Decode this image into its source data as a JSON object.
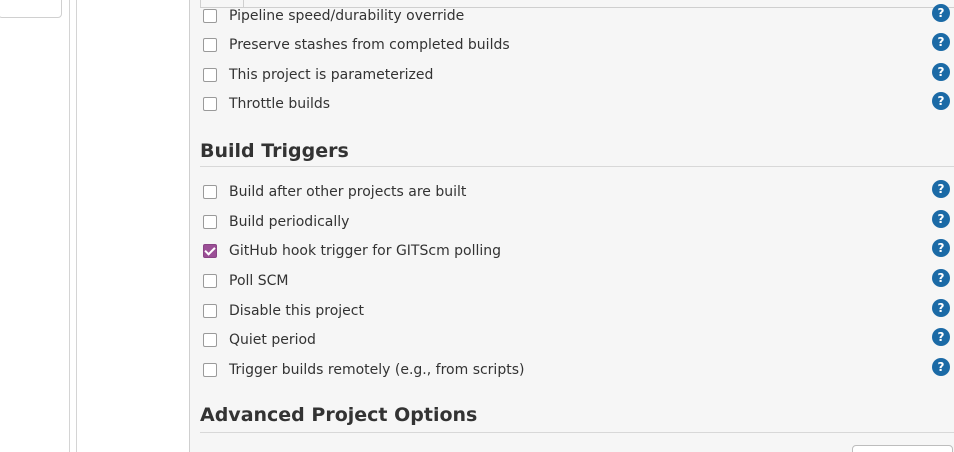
{
  "general_options": [
    {
      "label": "Pipeline speed/durability override",
      "checked": false
    },
    {
      "label": "Preserve stashes from completed builds",
      "checked": false
    },
    {
      "label": "This project is parameterized",
      "checked": false
    },
    {
      "label": "Throttle builds",
      "checked": false
    }
  ],
  "build_triggers": {
    "title": "Build Triggers",
    "options": [
      {
        "label": "Build after other projects are built",
        "checked": false
      },
      {
        "label": "Build periodically",
        "checked": false
      },
      {
        "label": "GitHub hook trigger for GITScm polling",
        "checked": true
      },
      {
        "label": "Poll SCM",
        "checked": false
      },
      {
        "label": "Disable this project",
        "checked": false
      },
      {
        "label": "Quiet period",
        "checked": false
      },
      {
        "label": "Trigger builds remotely (e.g., from scripts)",
        "checked": false
      }
    ]
  },
  "advanced_project_options": {
    "title": "Advanced Project Options"
  },
  "help_icon_glyph": "?",
  "colors": {
    "checkbox_checked": "#9b4f96",
    "help_icon": "#1b6aa6"
  }
}
